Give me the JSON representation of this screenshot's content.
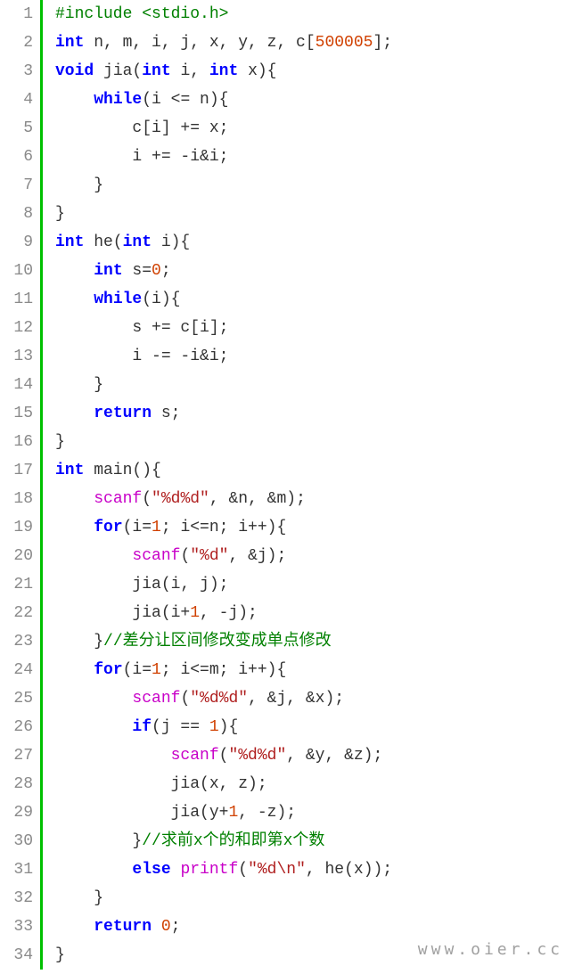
{
  "watermark": "www.oier.cc",
  "lines": [
    {
      "n": "1",
      "segs": [
        {
          "t": "#include <stdio.h>",
          "c": "pp"
        }
      ]
    },
    {
      "n": "2",
      "segs": [
        {
          "t": "int",
          "c": "kw"
        },
        {
          "t": " n, m, i, j, x, y, z, c["
        },
        {
          "t": "500005",
          "c": "num"
        },
        {
          "t": "];"
        }
      ]
    },
    {
      "n": "3",
      "segs": [
        {
          "t": "void",
          "c": "kw"
        },
        {
          "t": " jia("
        },
        {
          "t": "int",
          "c": "kw"
        },
        {
          "t": " i, "
        },
        {
          "t": "int",
          "c": "kw"
        },
        {
          "t": " x){"
        }
      ]
    },
    {
      "n": "4",
      "segs": [
        {
          "t": "    "
        },
        {
          "t": "while",
          "c": "kw"
        },
        {
          "t": "(i <= n){"
        }
      ]
    },
    {
      "n": "5",
      "segs": [
        {
          "t": "        c[i] += x;"
        }
      ]
    },
    {
      "n": "6",
      "segs": [
        {
          "t": "        i += -i&i;"
        }
      ]
    },
    {
      "n": "7",
      "segs": [
        {
          "t": "    }"
        }
      ]
    },
    {
      "n": "8",
      "segs": [
        {
          "t": "}"
        }
      ]
    },
    {
      "n": "9",
      "segs": [
        {
          "t": "int",
          "c": "kw"
        },
        {
          "t": " he("
        },
        {
          "t": "int",
          "c": "kw"
        },
        {
          "t": " i){"
        }
      ]
    },
    {
      "n": "10",
      "segs": [
        {
          "t": "    "
        },
        {
          "t": "int",
          "c": "kw"
        },
        {
          "t": " s="
        },
        {
          "t": "0",
          "c": "num"
        },
        {
          "t": ";"
        }
      ]
    },
    {
      "n": "11",
      "segs": [
        {
          "t": "    "
        },
        {
          "t": "while",
          "c": "kw"
        },
        {
          "t": "(i){"
        }
      ]
    },
    {
      "n": "12",
      "segs": [
        {
          "t": "        s += c[i];"
        }
      ]
    },
    {
      "n": "13",
      "segs": [
        {
          "t": "        i -= -i&i;"
        }
      ]
    },
    {
      "n": "14",
      "segs": [
        {
          "t": "    }"
        }
      ]
    },
    {
      "n": "15",
      "segs": [
        {
          "t": "    "
        },
        {
          "t": "return",
          "c": "kw"
        },
        {
          "t": " s;"
        }
      ]
    },
    {
      "n": "16",
      "segs": [
        {
          "t": "}"
        }
      ]
    },
    {
      "n": "17",
      "segs": [
        {
          "t": "int",
          "c": "kw"
        },
        {
          "t": " main(){"
        }
      ]
    },
    {
      "n": "18",
      "segs": [
        {
          "t": "    "
        },
        {
          "t": "scanf",
          "c": "fn"
        },
        {
          "t": "("
        },
        {
          "t": "\"%d%d\"",
          "c": "str"
        },
        {
          "t": ", &n, &m);"
        }
      ]
    },
    {
      "n": "19",
      "segs": [
        {
          "t": "    "
        },
        {
          "t": "for",
          "c": "kw"
        },
        {
          "t": "(i="
        },
        {
          "t": "1",
          "c": "num"
        },
        {
          "t": "; i<=n; i++){"
        }
      ]
    },
    {
      "n": "20",
      "segs": [
        {
          "t": "        "
        },
        {
          "t": "scanf",
          "c": "fn"
        },
        {
          "t": "("
        },
        {
          "t": "\"%d\"",
          "c": "str"
        },
        {
          "t": ", &j);"
        }
      ]
    },
    {
      "n": "21",
      "segs": [
        {
          "t": "        jia(i, j);"
        }
      ]
    },
    {
      "n": "22",
      "segs": [
        {
          "t": "        jia(i+"
        },
        {
          "t": "1",
          "c": "num"
        },
        {
          "t": ", -j);"
        }
      ]
    },
    {
      "n": "23",
      "segs": [
        {
          "t": "    }"
        },
        {
          "t": "//差分让区间修改变成单点修改",
          "c": "cmt"
        }
      ]
    },
    {
      "n": "24",
      "segs": [
        {
          "t": "    "
        },
        {
          "t": "for",
          "c": "kw"
        },
        {
          "t": "(i="
        },
        {
          "t": "1",
          "c": "num"
        },
        {
          "t": "; i<=m; i++){"
        }
      ]
    },
    {
      "n": "25",
      "segs": [
        {
          "t": "        "
        },
        {
          "t": "scanf",
          "c": "fn"
        },
        {
          "t": "("
        },
        {
          "t": "\"%d%d\"",
          "c": "str"
        },
        {
          "t": ", &j, &x);"
        }
      ]
    },
    {
      "n": "26",
      "segs": [
        {
          "t": "        "
        },
        {
          "t": "if",
          "c": "kw"
        },
        {
          "t": "(j == "
        },
        {
          "t": "1",
          "c": "num"
        },
        {
          "t": "){"
        }
      ]
    },
    {
      "n": "27",
      "segs": [
        {
          "t": "            "
        },
        {
          "t": "scanf",
          "c": "fn"
        },
        {
          "t": "("
        },
        {
          "t": "\"%d%d\"",
          "c": "str"
        },
        {
          "t": ", &y, &z);"
        }
      ]
    },
    {
      "n": "28",
      "segs": [
        {
          "t": "            jia(x, z);"
        }
      ]
    },
    {
      "n": "29",
      "segs": [
        {
          "t": "            jia(y+"
        },
        {
          "t": "1",
          "c": "num"
        },
        {
          "t": ", -z);"
        }
      ]
    },
    {
      "n": "30",
      "segs": [
        {
          "t": "        }"
        },
        {
          "t": "//求前x个的和即第x个数",
          "c": "cmt"
        }
      ]
    },
    {
      "n": "31",
      "segs": [
        {
          "t": "        "
        },
        {
          "t": "else",
          "c": "kw"
        },
        {
          "t": " "
        },
        {
          "t": "printf",
          "c": "fn"
        },
        {
          "t": "("
        },
        {
          "t": "\"%d\\n\"",
          "c": "str"
        },
        {
          "t": ", he(x));"
        }
      ]
    },
    {
      "n": "32",
      "segs": [
        {
          "t": "    }"
        }
      ]
    },
    {
      "n": "33",
      "segs": [
        {
          "t": "    "
        },
        {
          "t": "return",
          "c": "kw"
        },
        {
          "t": " "
        },
        {
          "t": "0",
          "c": "num"
        },
        {
          "t": ";"
        }
      ]
    },
    {
      "n": "34",
      "segs": [
        {
          "t": "}"
        }
      ]
    }
  ]
}
